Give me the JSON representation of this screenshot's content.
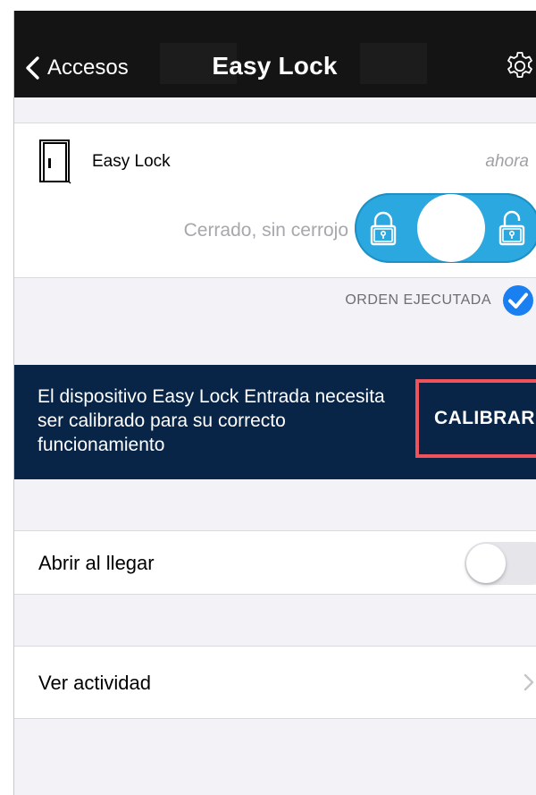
{
  "nav": {
    "back_label": "Accesos",
    "title": "Easy Lock",
    "icons": {
      "back": "chevron-left-icon",
      "settings": "gear-icon"
    }
  },
  "lock": {
    "name": "Easy Lock",
    "time": "ahora",
    "status": "Cerrado, sin cerrojo",
    "icons": {
      "device": "door-icon",
      "lock": "padlock-closed-icon",
      "unlock": "padlock-open-icon"
    },
    "toggle_color": "#2aa8df"
  },
  "order": {
    "label": "ORDEN EJECUTADA",
    "icon": "checkmark-circle-icon",
    "color": "#1a7ff0"
  },
  "calibration": {
    "message": "El dispositivo Easy Lock Entrada necesita ser calibrado para su correcto funcionamiento",
    "button_label": "CALIBRAR",
    "background": "#082548",
    "highlight": "#f0525c"
  },
  "settings": {
    "open_on_arrival": {
      "label": "Abrir al llegar",
      "enabled": false
    },
    "activity": {
      "label": "Ver actividad",
      "icon": "chevron-right-icon"
    }
  }
}
